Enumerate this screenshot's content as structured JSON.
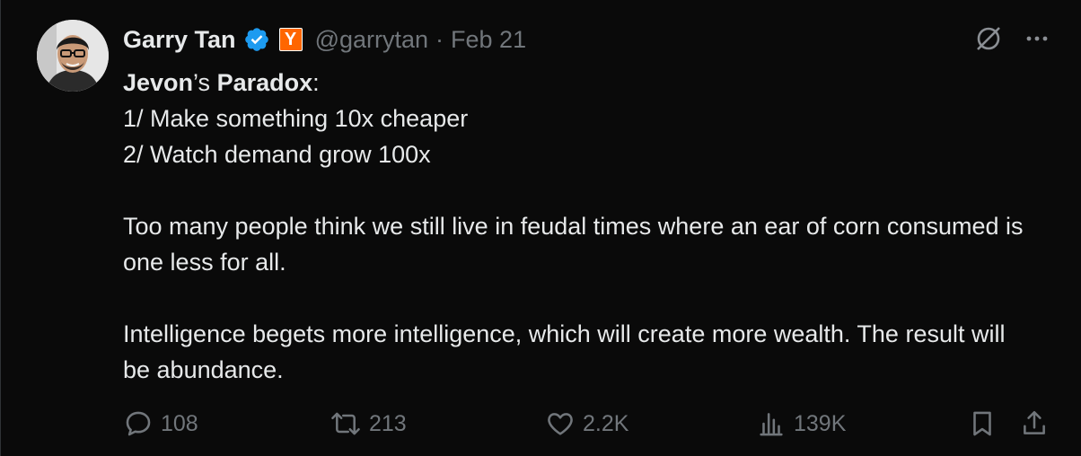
{
  "author": {
    "name": "Garry Tan",
    "handle": "@garrytan",
    "separator": "·",
    "date": "Feb 21",
    "org_badge_letter": "Y",
    "verified_color": "#1d9bf0",
    "org_badge_color": "#ff6600"
  },
  "tweet": {
    "title_part1": "Jevon",
    "title_part2": "’s ",
    "title_part3": "Paradox",
    "title_part4": ":",
    "line1": "1/ Make something 10x cheaper",
    "line2": "2/ Watch demand grow 100x",
    "para2": "Too many people think we still live in feudal times where an ear of corn consumed is one less for all.",
    "para3": "Intelligence begets more intelligence, which will create more wealth. The result will be abundance."
  },
  "actions": {
    "replies": "108",
    "reposts": "213",
    "likes": "2.2K",
    "views": "139K"
  },
  "icons": {
    "grok": "grok-icon",
    "more": "more-icon",
    "reply": "reply-icon",
    "repost": "repost-icon",
    "like": "heart-icon",
    "views": "views-icon",
    "bookmark": "bookmark-icon",
    "share": "share-icon"
  }
}
